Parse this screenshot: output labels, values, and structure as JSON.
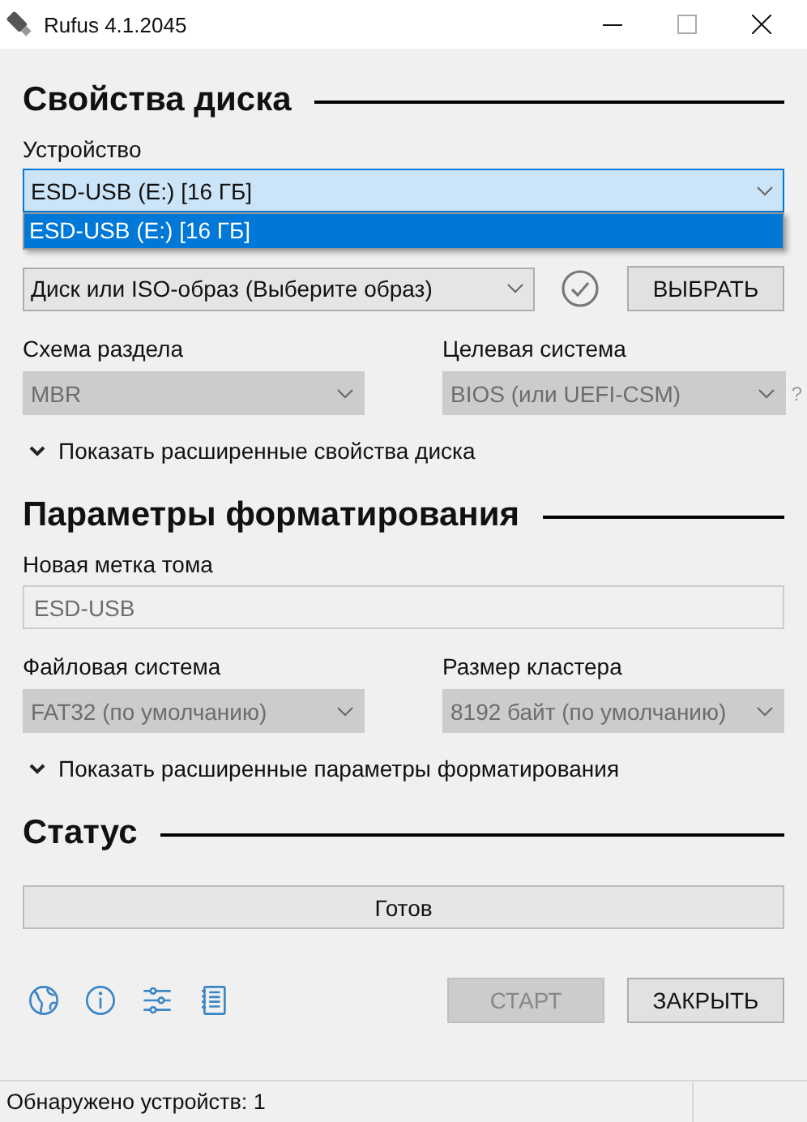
{
  "window": {
    "title": "Rufus 4.1.2045"
  },
  "drive_properties": {
    "heading": "Свойства диска",
    "device": {
      "label": "Устройство",
      "value": "ESD-USB (E:) [16 ГБ]",
      "expanded": true,
      "options": [
        {
          "label": "ESD-USB (E:) [16 ГБ]",
          "selected": true
        }
      ]
    },
    "boot_selection": {
      "value": "Диск или ISO-образ (Выберите образ)",
      "button": "ВЫБРАТЬ"
    },
    "partition_scheme": {
      "label": "Схема раздела",
      "value": "MBR",
      "disabled": true
    },
    "target_system": {
      "label": "Целевая система",
      "value": "BIOS (или UEFI-CSM)",
      "disabled": true,
      "help": "?"
    },
    "advanced_toggle": {
      "label": "Показать расширенные свойства диска",
      "expanded": false
    }
  },
  "format_options": {
    "heading": "Параметры форматирования",
    "volume_label": {
      "label": "Новая метка тома",
      "value": "ESD-USB",
      "disabled": true
    },
    "file_system": {
      "label": "Файловая система",
      "value": "FAT32 (по умолчанию)",
      "disabled": true
    },
    "cluster_size": {
      "label": "Размер кластера",
      "value": "8192 байт (по умолчанию)",
      "disabled": true
    },
    "advanced_toggle": {
      "label": "Показать расширенные параметры форматирования",
      "expanded": false
    }
  },
  "status": {
    "heading": "Статус",
    "progress": {
      "text": "Готов"
    }
  },
  "buttons": [
    {
      "label": "СТАРТ",
      "disabled": true
    },
    {
      "label": "ЗАКРЫТЬ",
      "disabled": false
    }
  ],
  "status_bar": {
    "text": "Обнаружено устройств: 1"
  }
}
